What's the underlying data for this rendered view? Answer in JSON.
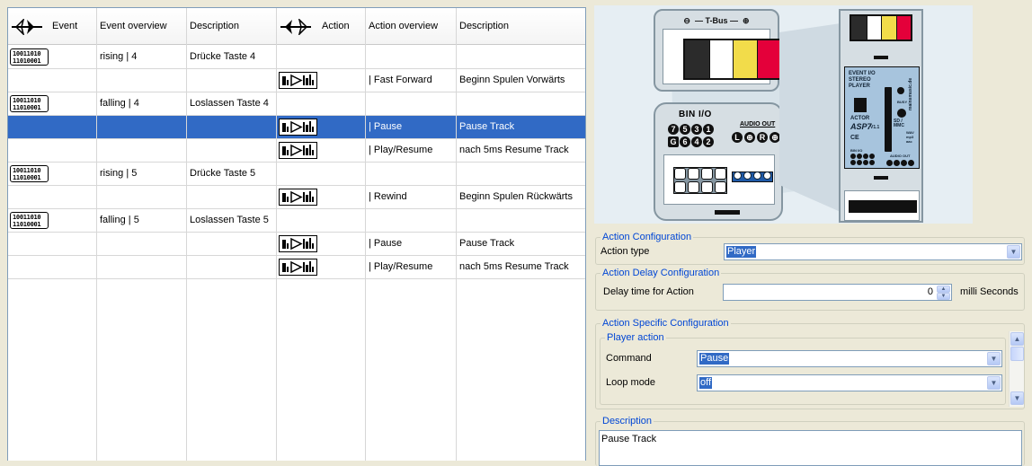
{
  "grid": {
    "headers": {
      "event": "Event",
      "event_overview": "Event overview",
      "description": "Description",
      "action": "Action",
      "action_overview": "Action overview",
      "action_description": "Description"
    },
    "event_icon_text": [
      "10011010",
      "11010001"
    ],
    "rows": [
      {
        "type": "event",
        "overview": "rising | 4",
        "description": "Drücke Taste 4"
      },
      {
        "type": "action",
        "overview": "| Fast Forward",
        "description": "Beginn Spulen Vorwärts"
      },
      {
        "type": "event",
        "overview": "falling | 4",
        "description": "Loslassen Taste 4"
      },
      {
        "type": "action",
        "overview": "| Pause",
        "description": "Pause Track",
        "selected": true
      },
      {
        "type": "action",
        "overview": "| Play/Resume",
        "description": "nach 5ms Resume Track"
      },
      {
        "type": "event",
        "overview": "rising | 5",
        "description": "Drücke Taste 5"
      },
      {
        "type": "action",
        "overview": "| Rewind",
        "description": "Beginn Spulen Rückwärts"
      },
      {
        "type": "event",
        "overview": "falling | 5",
        "description": "Loslassen Taste 5"
      },
      {
        "type": "action",
        "overview": "| Pause",
        "description": "Pause Track"
      },
      {
        "type": "action",
        "overview": "| Play/Resume",
        "description": "nach 5ms Resume Track"
      }
    ]
  },
  "device": {
    "tbus_label": "T-Bus",
    "tbus_minus": "⊖",
    "tbus_plus": "⊕",
    "bin_io_label": "BIN I/O",
    "audio_out_label": "AUDIO OUT",
    "bin_top": [
      "7",
      "5",
      "3",
      "1"
    ],
    "bin_bottom_g": "G",
    "bin_bottom": [
      "6",
      "4",
      "2"
    ],
    "audio_ports": [
      "L",
      "⊕",
      "R",
      "⊕"
    ],
    "stripe_colors": [
      "#2b2b2b",
      "#ffffff",
      "#f2dc4a",
      "#e4003a"
    ],
    "module": {
      "title_lines": [
        "EVENT I/O",
        "STEREO",
        "PLAYER"
      ],
      "actor": "ACTOR",
      "model": "ASP7",
      "version": "V1.1",
      "ce": "CE",
      "busy": "BUSY",
      "sd": "SD / MMC",
      "formats": [
        "WAV",
        "mp3",
        "aac"
      ],
      "brand": "mainsmusic.de",
      "bin_io": "BIN I/O",
      "audio_out": "AUDIO OUT"
    }
  },
  "config": {
    "action_configuration": {
      "title": "Action Configuration",
      "action_type_label": "Action type",
      "action_type_value": "Player"
    },
    "delay": {
      "title": "Action Delay Configuration",
      "label": "Delay time for Action",
      "value": "0",
      "unit": "milli Seconds"
    },
    "specific": {
      "title": "Action Specific Configuration",
      "player_action_title": "Player action",
      "command_label": "Command",
      "command_value": "Pause",
      "loop_label": "Loop mode",
      "loop_value": "off"
    },
    "description": {
      "title": "Description",
      "value": "Pause Track"
    }
  }
}
